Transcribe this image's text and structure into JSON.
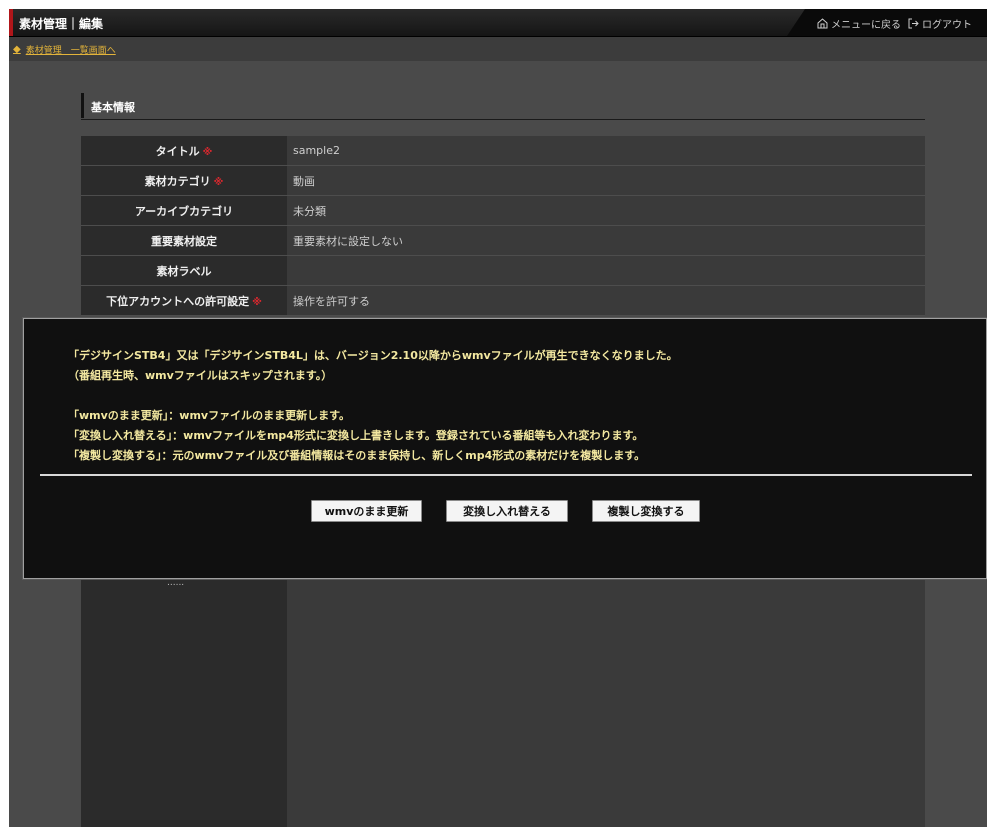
{
  "header": {
    "title": "素材管理｜編集",
    "menu_link": "メニューに戻る",
    "logout_link": "ログアウト"
  },
  "breadcrumb": {
    "back_link": "素材管理　一覧画面へ"
  },
  "section": {
    "title": "基本情報"
  },
  "form": {
    "required_mark": "※",
    "rows": [
      {
        "label": "タイトル",
        "value": "sample2"
      },
      {
        "label": "素材カテゴリ",
        "value": "動画"
      },
      {
        "label": "アーカイブカテゴリ",
        "value": "未分類"
      },
      {
        "label": "重要素材設定",
        "value": "重要素材に設定しない"
      },
      {
        "label": "素材ラベル",
        "value": ""
      },
      {
        "label": "下位アカウントへの許可設定",
        "value": "操作を許可する"
      }
    ],
    "partial_label": "......"
  },
  "dialog": {
    "lines": [
      "「デジサインSTB4」又は「デジサインSTB4L」は、バージョン2.10以降からwmvファイルが再生できなくなりました。",
      "（番組再生時、wmvファイルはスキップされます。）",
      "「wmvのまま更新」：wmvファイルのまま更新します。",
      "「変換し入れ替える」：wmvファイルをmp4形式に変換し上書きします。登録されている番組等も入れ変わります。",
      "「複製し変換する」：元のwmvファイル及び番組情報はそのまま保持し、新しくmp4形式の素材だけを複製します。"
    ],
    "buttons": {
      "keep_wmv": "wmvのまま更新",
      "convert_replace": "変換し入れ替える",
      "duplicate_convert": "複製し変換する"
    }
  },
  "colors": {
    "accent_red": "#b0161a",
    "link_gold": "#e3b43a",
    "required_red": "#d6282e",
    "dialog_text": "#f3e8a0"
  }
}
